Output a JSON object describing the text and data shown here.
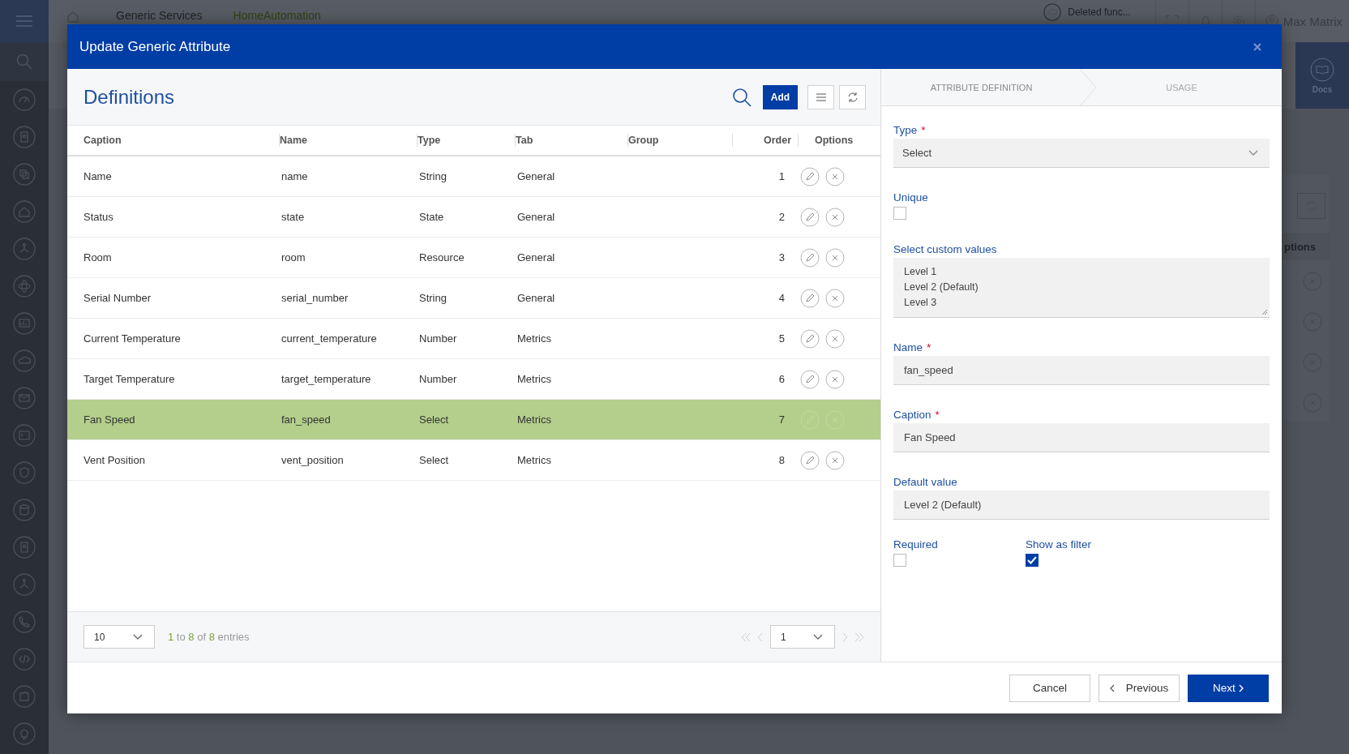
{
  "background": {
    "breadcrumbs": [
      "Generic Services",
      "HomeAutomation"
    ],
    "notification": "Deleted func...",
    "user": "Max Matrix",
    "docs": "Docs",
    "column_heading": "ptions"
  },
  "dialog": {
    "title": "Update Generic Attribute",
    "definitions": {
      "title": "Definitions",
      "add_button": "Add",
      "columns": [
        "Caption",
        "Name",
        "Type",
        "Tab",
        "Group",
        "Order",
        "Options"
      ],
      "rows": [
        {
          "caption": "Name",
          "name": "name",
          "type": "String",
          "tab": "General",
          "order": "1",
          "selected": false
        },
        {
          "caption": "Status",
          "name": "state",
          "type": "State",
          "tab": "General",
          "order": "2",
          "selected": false
        },
        {
          "caption": "Room",
          "name": "room",
          "type": "Resource",
          "tab": "General",
          "order": "3",
          "selected": false
        },
        {
          "caption": "Serial Number",
          "name": "serial_number",
          "type": "String",
          "tab": "General",
          "order": "4",
          "selected": false
        },
        {
          "caption": "Current Temperature",
          "name": "current_temperature",
          "type": "Number",
          "tab": "Metrics",
          "order": "5",
          "selected": false
        },
        {
          "caption": "Target Temperature",
          "name": "target_temperature",
          "type": "Number",
          "tab": "Metrics",
          "order": "6",
          "selected": false
        },
        {
          "caption": "Fan Speed",
          "name": "fan_speed",
          "type": "Select",
          "tab": "Metrics",
          "order": "7",
          "selected": true
        },
        {
          "caption": "Vent Position",
          "name": "vent_position",
          "type": "Select",
          "tab": "Metrics",
          "order": "8",
          "selected": false
        }
      ],
      "page_size": "10",
      "summary": [
        {
          "text": "1",
          "highlight": true
        },
        {
          "text": "to",
          "highlight": false
        },
        {
          "text": "8",
          "highlight": true
        },
        {
          "text": "of",
          "highlight": false
        },
        {
          "text": "8",
          "highlight": true
        },
        {
          "text": "entries",
          "highlight": false
        }
      ],
      "page": "1"
    },
    "form": {
      "steps": [
        {
          "label": "ATTRIBUTE DEFINITION",
          "selected": true
        },
        {
          "label": "USAGE",
          "selected": false
        }
      ],
      "fields": [
        {
          "kind": "select",
          "label": "Type",
          "required_mark": "*",
          "value": "Select"
        },
        {
          "kind": "checkbox",
          "label": "Unique",
          "checked": false
        },
        {
          "kind": "textarea",
          "label": "Select custom values",
          "lines": [
            "Level 1",
            "Level 2 (Default)",
            "Level 3"
          ]
        },
        {
          "kind": "text",
          "label": "Name",
          "required_mark": "*",
          "value": "fan_speed"
        },
        {
          "kind": "text",
          "label": "Caption",
          "required_mark": "*",
          "value": "Fan Speed"
        },
        {
          "kind": "text",
          "label": "Default value",
          "value": "Level 2 (Default)"
        }
      ],
      "flags": [
        {
          "label": "Required",
          "checked": false
        },
        {
          "label": "Show as filter",
          "checked": true
        }
      ]
    },
    "buttons": [
      {
        "label": "Cancel",
        "kind": "plain"
      },
      {
        "label": "Previous",
        "kind": "back"
      },
      {
        "label": "Next",
        "kind": "primary"
      }
    ]
  }
}
